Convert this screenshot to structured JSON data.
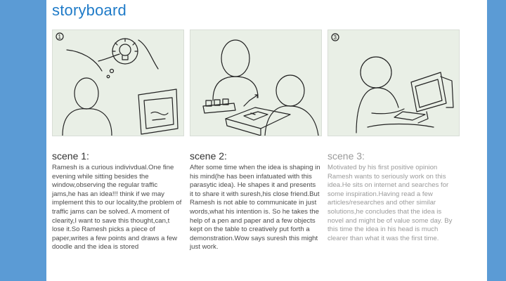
{
  "title": "storyboard",
  "panels": [
    {
      "number": "1",
      "icon": "lightbulb-idea-icon"
    },
    {
      "number": "2",
      "icon": "paper-and-objects-icon"
    },
    {
      "number": "3",
      "icon": "computer-icon"
    }
  ],
  "scenes": [
    {
      "heading": "scene 1:",
      "text": "Ramesh is a curious indivivdual.One fine evening while sitting besides the window,observing the regular traffic jams,he has an idea!!! think if we may implement this to our locality,the problem of traffic jams can be solved. A moment of clearity,I want to save this thought,can,t lose it.So Ramesh picks a piece of paper,writes a few points and draws a few doodle and the idea is stored"
    },
    {
      "heading": "scene 2:",
      "text": "After some time when the idea is shaping in his mind(he has been infatuated with this parasytic idea). He shapes it and presents it to share it with suresh,his close friend.But Ramesh is not able to communicate in just words,what his intention is. So he takes the help of a pen and paper and a few objects kept on the table to creatively put forth a demonstration.Wow says suresh this might just work."
    },
    {
      "heading": "scene 3:",
      "text": "Motivated by his first positive opinion Ramesh wants to seriously work on this idea.He sits on internet and searches for some inspiration.Having read a few articles/researches and other similar solutions,he concludes that the idea is novel and might be of value some day. By this time the idea in his head is much clearer than what it was the first time."
    }
  ]
}
